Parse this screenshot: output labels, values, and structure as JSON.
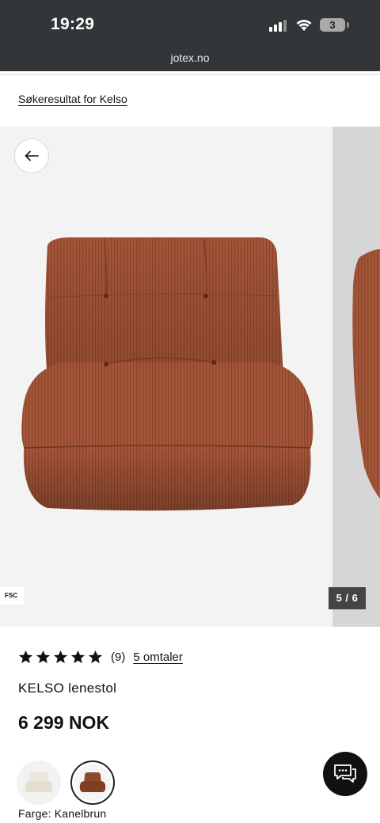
{
  "status": {
    "time": "19:29",
    "battery": "3"
  },
  "browser": {
    "url": "jotex.no"
  },
  "breadcrumb": {
    "label": "Søkeresultat for Kelso"
  },
  "gallery": {
    "badge": "FSC",
    "counter": "5 / 6",
    "current_index": 5,
    "total": 6,
    "back_icon": "arrow-left-icon"
  },
  "product": {
    "rating_value": 5,
    "rating_count": "(9)",
    "reviews_link": "5 omtaler",
    "name": "KELSO lenestol",
    "price": "6 299 NOK",
    "color_label": "Farge: Kanelbrun"
  },
  "swatches": [
    {
      "name": "cream",
      "color": "#ece7dc",
      "selected": false
    },
    {
      "name": "cinnamon",
      "color": "#8e4a2b",
      "selected": true
    }
  ],
  "colors": {
    "header_bg": "#333638",
    "product_color": "#a4563a",
    "gallery_bg": "#f3f3f3"
  },
  "chat": {
    "icon": "chat-icon"
  }
}
